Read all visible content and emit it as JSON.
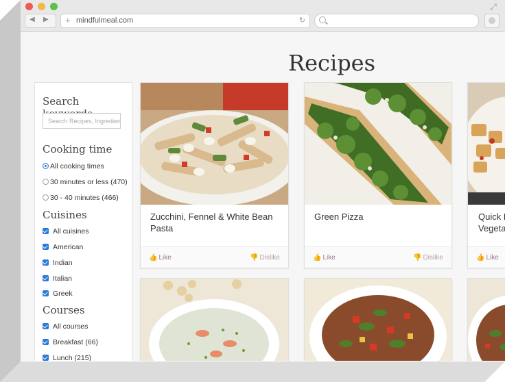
{
  "browser": {
    "url": "mindfulmeal.com",
    "plus_glyph": "+",
    "back_glyph": "◀",
    "forward_glyph": "▶",
    "reload_glyph": "↻",
    "expand_glyph": "⤢"
  },
  "page": {
    "title": "Recipes"
  },
  "sidebar": {
    "search_heading": "Search keywords",
    "search_placeholder": "Search Recipes, Ingredients",
    "cooking_time_heading": "Cooking time",
    "cooking_time_options": [
      {
        "label": "All cooking times",
        "selected": true
      },
      {
        "label": "30 minutes or less (470)",
        "selected": false
      },
      {
        "label": "30 - 40 minutes (466)",
        "selected": false
      }
    ],
    "cuisines_heading": "Cuisines",
    "cuisines": [
      {
        "label": "All cuisines",
        "checked": true
      },
      {
        "label": "American",
        "checked": true
      },
      {
        "label": "Indian",
        "checked": true
      },
      {
        "label": "Italian",
        "checked": true
      },
      {
        "label": "Greek",
        "checked": true
      }
    ],
    "courses_heading": "Courses",
    "courses": [
      {
        "label": "All courses",
        "checked": true
      },
      {
        "label": "Breakfast (66)",
        "checked": true
      },
      {
        "label": "Lunch (215)",
        "checked": true
      }
    ]
  },
  "cards": [
    {
      "title": "Zucchini, Fennel & White Bean Pasta",
      "like": "Like",
      "dislike": "Dislike",
      "image": "pasta-photo"
    },
    {
      "title": "Green Pizza",
      "like": "Like",
      "dislike": "Dislike",
      "image": "green-pizza-photo"
    },
    {
      "title": "Quick P Vegeta",
      "like": "Like",
      "image": "potato-photo"
    }
  ],
  "colors": {
    "accent": "#2a7ad8",
    "like": "#9a7a88"
  }
}
